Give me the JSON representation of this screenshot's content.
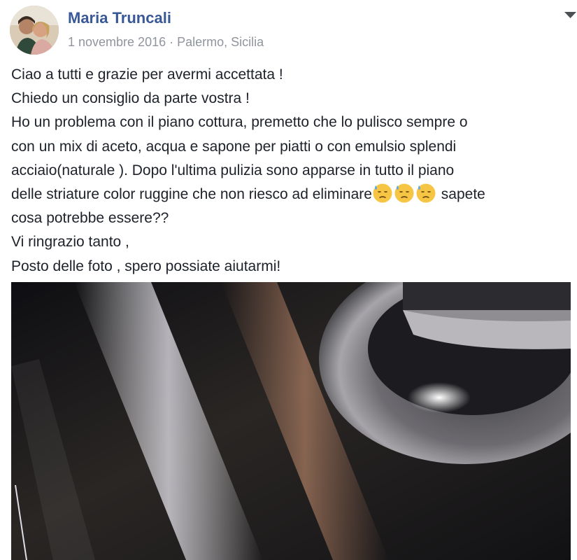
{
  "post": {
    "author": "Maria Truncali",
    "date": "1 novembre 2016",
    "separator": "·",
    "location": "Palermo, Sicilia",
    "options_icon": "chevron-down-icon",
    "text_lines": {
      "l1": "Ciao a tutti e grazie per avermi accettata !",
      "l2": "Chiedo un consiglio da parte vostra !",
      "l3": "Ho un problema con il piano cottura, premetto che lo pulisco sempre o",
      "l4": "con un mix di aceto, acqua e sapone per piatti o con emulsio splendi",
      "l5": "acciaio(naturale ). Dopo l'ultima pulizia sono apparse in tutto il piano",
      "l6_before": "delle striature color ruggine che non riesco ad eliminare",
      "l6_after": " sapete",
      "l7": "cosa potrebbe essere??",
      "l8": "Vi ringrazio tanto ,",
      "l9": "Posto delle foto , spero possiate aiutarmi!"
    },
    "emoji": [
      "downcast-face-with-sweat-emoji",
      "downcast-face-with-sweat-emoji",
      "downcast-face-with-sweat-emoji"
    ],
    "photo": "stainless-steel-cooktop-with-rust-stains"
  }
}
